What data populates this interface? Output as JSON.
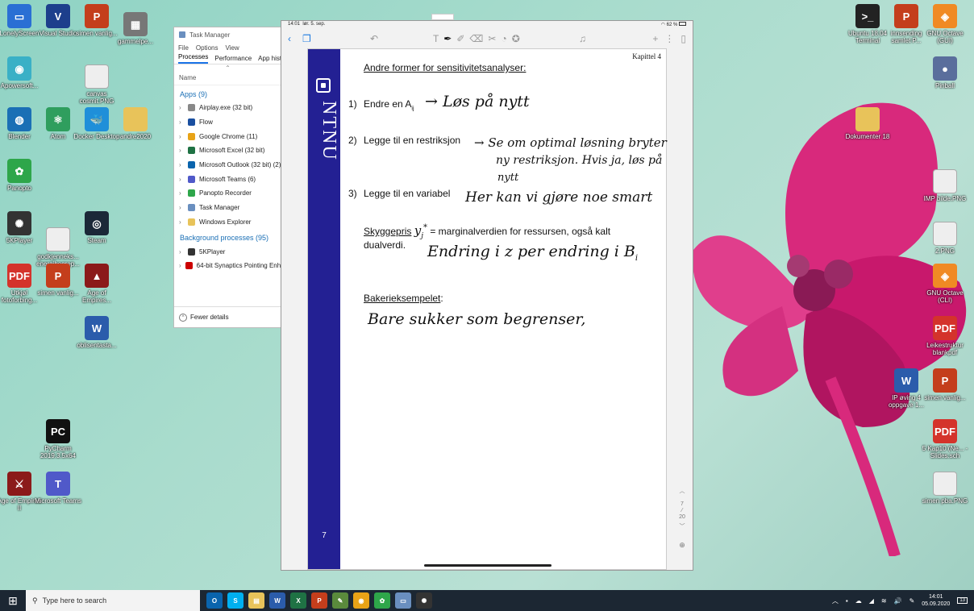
{
  "desktop_icons_left": [
    {
      "label": "LonelyScreen",
      "color": "#2a6fd4",
      "glyph": "▭",
      "pos": "a"
    },
    {
      "label": "Visual Studio",
      "color": "#1d3f8c",
      "glyph": "V",
      "pos": "b"
    },
    {
      "label": "simen vanlig...",
      "color": "#c43e1c",
      "glyph": "P",
      "pos": "c"
    },
    {
      "label": "gammelpe...",
      "color": "#777",
      "glyph": "▦",
      "pos": "d"
    },
    {
      "label": "Apowersoft...",
      "color": "#3ab0c6",
      "glyph": "◉",
      "pos": "e"
    },
    {
      "label": "canvas cosmit.PNG",
      "color": "#eee",
      "glyph": "",
      "pos": "f"
    },
    {
      "label": "Blender",
      "color": "#1a6fb5",
      "glyph": "◍",
      "pos": "g"
    },
    {
      "label": "Atom",
      "color": "#2f9e5e",
      "glyph": "⚛",
      "pos": "h"
    },
    {
      "label": "Docker Desktop",
      "color": "#1f8fd9",
      "glyph": "🐳",
      "pos": "i"
    },
    {
      "label": "andre2020",
      "color": "#e8c35a",
      "glyph": "",
      "pos": "j"
    },
    {
      "label": "Panopto",
      "color": "#2ea64a",
      "glyph": "✿",
      "pos": "k"
    },
    {
      "label": "5KPlayer",
      "color": "#333",
      "glyph": "✺",
      "pos": "l"
    },
    {
      "label": "godkjenneks... energibegrep...",
      "color": "#eee",
      "glyph": "",
      "pos": "m"
    },
    {
      "label": "Steam",
      "color": "#1b2838",
      "glyph": "◎",
      "pos": "n"
    },
    {
      "label": "Utkjøl fotoforbing...",
      "color": "#d4332b",
      "glyph": "PDF",
      "pos": "o"
    },
    {
      "label": "simen vanlig...",
      "color": "#c43e1c",
      "glyph": "P",
      "pos": "p"
    },
    {
      "label": "Age of Empires...",
      "color": "#8b1a1a",
      "glyph": "▲",
      "pos": "q"
    },
    {
      "label": "oblisentasta...",
      "color": "#2b5cab",
      "glyph": "W",
      "pos": "r"
    },
    {
      "label": "PyCharm 2019.3.5x64",
      "color": "#111",
      "glyph": "PC",
      "pos": "s"
    },
    {
      "label": "Age of Empires II",
      "color": "#8b1a1a",
      "glyph": "⚔",
      "pos": "t"
    },
    {
      "label": "Microsoft Teams",
      "color": "#5059c9",
      "glyph": "T",
      "pos": "u"
    }
  ],
  "desktop_icons_right": [
    {
      "label": "Ubuntu 18.04 Terminal",
      "color": "#222",
      "glyph": ">_",
      "pos": "A"
    },
    {
      "label": "innsending samlet P...",
      "color": "#c43e1c",
      "glyph": "P",
      "pos": "B"
    },
    {
      "label": "GNU Octave (GUI)",
      "color": "#f08a24",
      "glyph": "◈",
      "pos": "C"
    },
    {
      "label": "Pinball",
      "color": "#5a6e9c",
      "glyph": "●",
      "pos": "D"
    },
    {
      "label": "Dokumenter 18",
      "color": "#e8c35a",
      "glyph": "",
      "pos": "E"
    },
    {
      "label": "IMP bilde.PNG",
      "color": "#eee",
      "glyph": "",
      "pos": "F"
    },
    {
      "label": "2.PNG",
      "color": "#eee",
      "glyph": "",
      "pos": "G"
    },
    {
      "label": "GNU Octave (CLI)",
      "color": "#f08a24",
      "glyph": "◈",
      "pos": "H"
    },
    {
      "label": "Leikestruktur blankpdf",
      "color": "#d4332b",
      "glyph": "PDF",
      "pos": "I"
    },
    {
      "label": "IP øving 4 oppgave 1...",
      "color": "#2b5cab",
      "glyph": "W",
      "pos": "J"
    },
    {
      "label": "simen vanlig...",
      "color": "#c43e1c",
      "glyph": "P",
      "pos": "K"
    },
    {
      "label": "5 Kap10 (Ne... - Slides.sch",
      "color": "#d4332b",
      "glyph": "PDF",
      "pos": "L"
    },
    {
      "label": "simen pba.PNG",
      "color": "#eee",
      "glyph": "",
      "pos": "M"
    }
  ],
  "task_manager": {
    "title": "Task Manager",
    "menu": [
      "File",
      "Options",
      "View"
    ],
    "tabs": [
      "Processes",
      "Performance",
      "App history"
    ],
    "column": "Name",
    "apps_header": "Apps (9)",
    "apps": [
      {
        "name": "Airplay.exe (32 bit)",
        "color": "#888"
      },
      {
        "name": "Flow",
        "color": "#1a4fa0"
      },
      {
        "name": "Google Chrome (11)",
        "color": "#e8a317"
      },
      {
        "name": "Microsoft Excel (32 bit)",
        "color": "#1f7244"
      },
      {
        "name": "Microsoft Outlook (32 bit) (2)",
        "color": "#0a64ad"
      },
      {
        "name": "Microsoft Teams (6)",
        "color": "#5059c9"
      },
      {
        "name": "Panopto Recorder",
        "color": "#2ea64a"
      },
      {
        "name": "Task Manager",
        "color": "#6a8fbf"
      },
      {
        "name": "Windows Explorer",
        "color": "#e8c35a"
      }
    ],
    "bg_header": "Background processes (95)",
    "bg": [
      {
        "name": "5KPlayer",
        "color": "#333"
      },
      {
        "name": "64-bit Synaptics Pointing Enha",
        "color": "#c00"
      }
    ],
    "fewer": "Fewer details"
  },
  "ipad": {
    "status_time": "14:01",
    "status_date": "lør. 5. sep.",
    "status_battery": "62 %",
    "chapter": "Kapittel 4",
    "heading": "Andre former for sensitivitetsanalyser:",
    "item1_num": "1)",
    "item1": "Endre en A",
    "item1_sub": "ij",
    "item2_num": "2)",
    "item2": "Legge til en restriksjon",
    "item3_num": "3)",
    "item3": "Legge til en variabel",
    "shadow_word": "Skyggepris",
    "shadow_sym": "y",
    "shadow_sub": "j",
    "shadow_sup": "*",
    "shadow_rest": " = marginalverdien for ressursen, også kalt",
    "shadow_line2": "dualverdi.",
    "bakeri": "Bakerieksempelet",
    "bakeri_colon": ":",
    "hand1": "→ Løs på nytt",
    "hand2a": "→ Se om optimal løsning bryter",
    "hand2b": "ny restriksjon. Hvis ja, løs på",
    "hand2c": "nytt",
    "hand3": "Her kan vi gjøre noe smart",
    "hand4": "Endring i z per endring i B",
    "hand4_sub": "i",
    "hand5": "Bare sukker som begrenser,",
    "ntnu": "NTNU",
    "page_number": "7",
    "nav_page": "7",
    "nav_total": "20"
  },
  "taskbar": {
    "search_placeholder": "Type here to search",
    "icons": [
      {
        "name": "outlook",
        "color": "#0a64ad",
        "glyph": "O"
      },
      {
        "name": "skype",
        "color": "#00aff0",
        "glyph": "S"
      },
      {
        "name": "file-explorer",
        "color": "#e8c35a",
        "glyph": "▤"
      },
      {
        "name": "word",
        "color": "#2b5cab",
        "glyph": "W"
      },
      {
        "name": "excel",
        "color": "#1f7244",
        "glyph": "X"
      },
      {
        "name": "powerpoint",
        "color": "#c43e1c",
        "glyph": "P"
      },
      {
        "name": "notepad",
        "color": "#5a8a3c",
        "glyph": "✎"
      },
      {
        "name": "chrome",
        "color": "#e8a317",
        "glyph": "◉"
      },
      {
        "name": "panopto",
        "color": "#2ea64a",
        "glyph": "✿"
      },
      {
        "name": "remote",
        "color": "#6a8fbf",
        "glyph": "▭"
      },
      {
        "name": "5kplayer",
        "color": "#333",
        "glyph": "✺"
      }
    ],
    "time": "14:01",
    "date": "05.09.2020",
    "notif_count": "13"
  }
}
